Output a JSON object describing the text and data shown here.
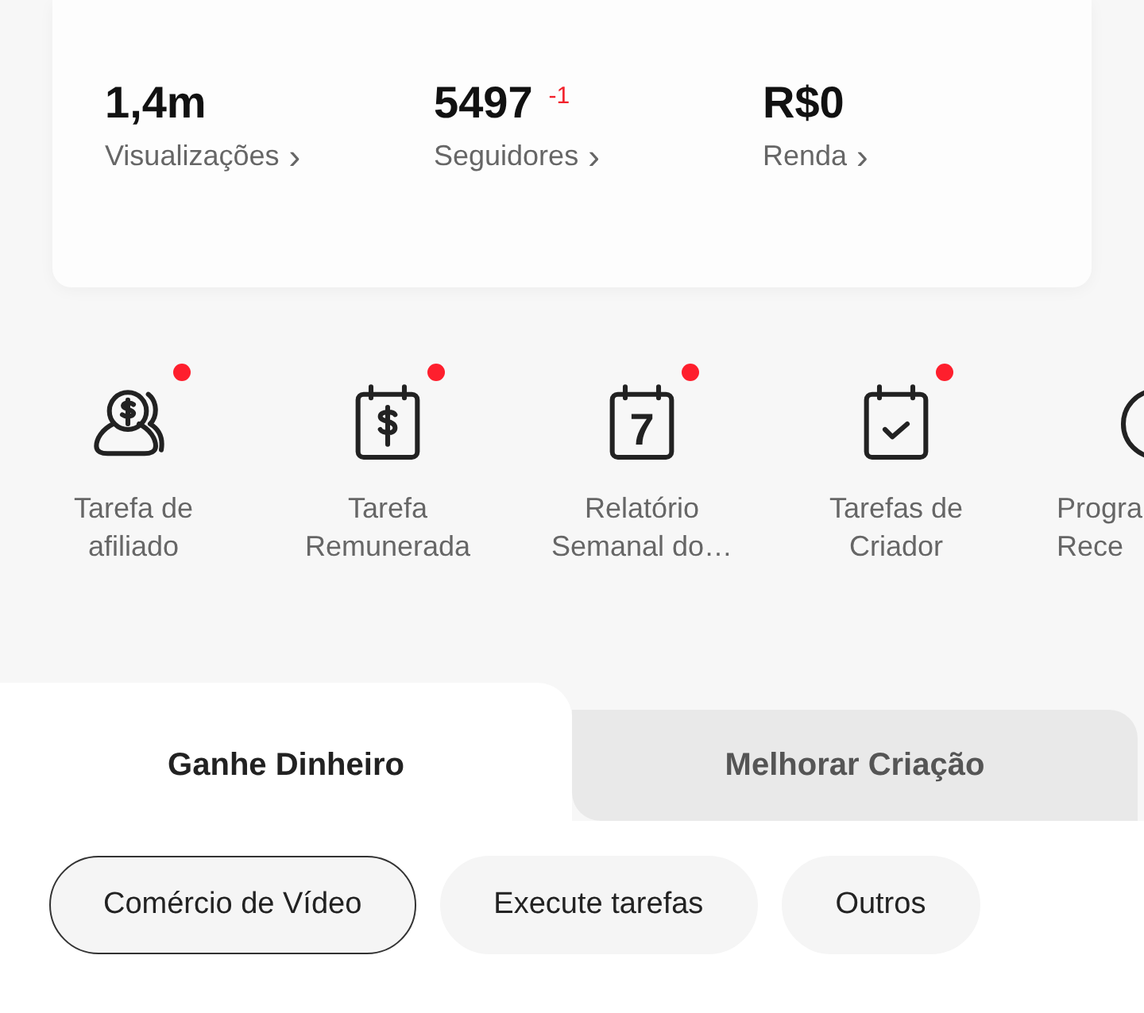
{
  "stats": [
    {
      "value": "1,4m",
      "label": "Visualizações",
      "chevron": "›"
    },
    {
      "value": "5497",
      "delta": "-1",
      "label": "Seguidores",
      "chevron": "›"
    },
    {
      "value": "R$0",
      "label": "Renda",
      "chevron": "›"
    }
  ],
  "shortcuts": [
    {
      "kind": "people",
      "lines": [
        "Tarefa de",
        "afiliado"
      ],
      "dot": true
    },
    {
      "kind": "dollar-calendar",
      "lines": [
        "Tarefa",
        "Remunerada"
      ],
      "dot": true
    },
    {
      "kind": "number-calendar",
      "glyph": "7",
      "lines": [
        "Relatório",
        "Semanal do…"
      ],
      "dot": true
    },
    {
      "kind": "check-calendar",
      "lines": [
        "Tarefas de",
        "Criador"
      ],
      "dot": true
    },
    {
      "kind": "coin",
      "lines": [
        "Progra",
        "Rece"
      ]
    }
  ],
  "tabs": [
    {
      "label": "Ganhe Dinheiro",
      "selected": true
    },
    {
      "label": "Melhorar Criação",
      "selected": false
    }
  ],
  "filters": [
    {
      "label": "Comércio de Vídeo",
      "selected": true
    },
    {
      "label": "Execute tarefas",
      "selected": false
    },
    {
      "label": "Outros",
      "selected": false
    }
  ]
}
